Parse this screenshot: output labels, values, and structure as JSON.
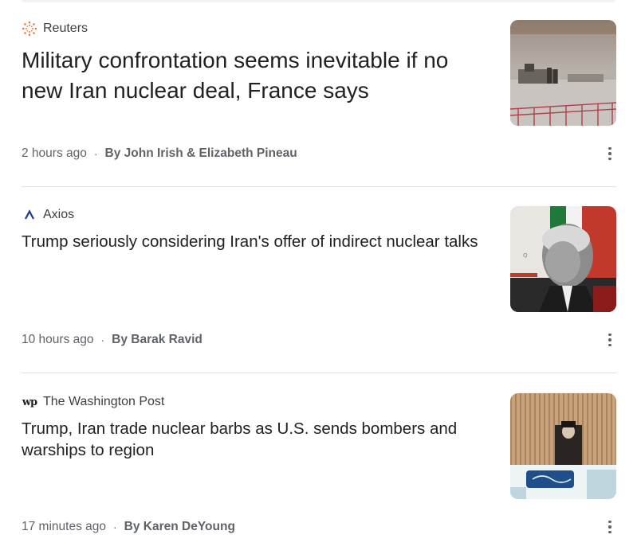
{
  "articles": [
    {
      "source": "Reuters",
      "source_icon": "reuters-logo-icon",
      "headline": "Military confrontation seems inevitable if no new Iran nuclear deal, France says",
      "time": "2 hours ago",
      "separator": "·",
      "byline": "By John Irish & Elizabeth Pineau",
      "thumbnail": "desert-convoy-image"
    },
    {
      "source": "Axios",
      "source_icon": "axios-logo-icon",
      "headline": "Trump seriously considering Iran's offer of indirect nuclear talks",
      "time": "10 hours ago",
      "separator": "·",
      "byline": "By Barak Ravid",
      "thumbnail": "trump-iran-flag-image"
    },
    {
      "source": "The Washington Post",
      "source_icon": "washington-post-logo-icon",
      "source_logo_text": "wp",
      "headline": "Trump, Iran trade nuclear barbs as U.S. sends bombers and warships to region",
      "time": "17 minutes ago",
      "separator": "·",
      "byline": "By Karen DeYoung",
      "thumbnail": "iran-leader-podium-image"
    }
  ],
  "colors": {
    "headline": "#202124",
    "meta": "#5f6368",
    "divider": "#e0e0e0",
    "reuters_orange": "#e8793a",
    "axios_blue": "#1a3c8c"
  }
}
